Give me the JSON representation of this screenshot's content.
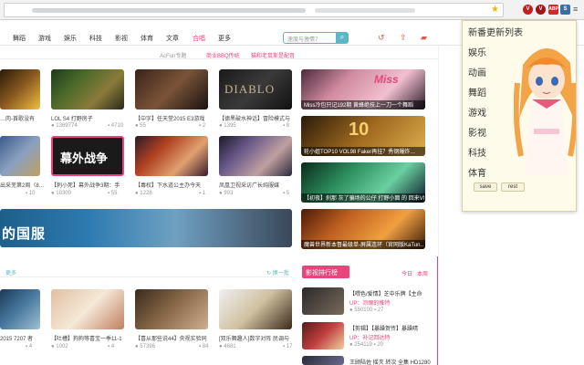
{
  "browser": {
    "ext_icons": [
      "V",
      "V",
      "ABP",
      "⚙",
      "S"
    ]
  },
  "nav": {
    "items": [
      "舞蹈",
      "游戏",
      "娱乐",
      "科技",
      "影视",
      "体育",
      "文章",
      "合唱",
      "更多"
    ],
    "active_index": 7,
    "search_placeholder": "速度与激情7",
    "icons": [
      "history-icon",
      "upload-icon",
      "folder-icon"
    ]
  },
  "subbar": {
    "items": [
      "AcFun专题",
      "商业BBQ传统",
      "猫和老鼠斯是配音"
    ]
  },
  "grid_row1": [
    {
      "title": "…肉-首歌没有",
      "stat1": "",
      "stat2": ""
    },
    {
      "title": "LOL S4 打野房子",
      "stat1": "1369774",
      "stat2": "4710"
    },
    {
      "title": "【中字】任天堂2015 E3游戏",
      "stat1": "55",
      "stat2": "2"
    },
    {
      "title": "【德黑破水神话】冒险模式与",
      "stat1": "1395",
      "stat2": "8"
    }
  ],
  "grid_row2": [
    {
      "title": "出采芜第2周（8…",
      "stat1": "10",
      "stat2": ""
    },
    {
      "title": "【刺小死】幕外战争3期：手",
      "stat1": "10300",
      "stat2": "55"
    },
    {
      "title": "【毒权】下水道公主办今天",
      "stat1": "1228",
      "stat2": "1"
    },
    {
      "title": "凤凰卫视采访广长纯服媒",
      "stat1": "993",
      "stat2": "5"
    }
  ],
  "right_feature": [
    "Miss冷包只记192期 黄蜂绝技上一刀一个舞蹈",
    "轮小姐TOP10 VOL98 Faker再挂？秀钢爆炸…",
    "【初夜】刹那 灰了骗场的公仔 打野小面 的 回来VN…",
    "魔兽世界新本督最级单-屏属连环（官网版KaTun…"
  ],
  "thumb_texts": {
    "fan": "幕外战争",
    "diablo": "DIABLO",
    "miss": "Miss",
    "ten": "10"
  },
  "banner": {
    "text": "的国服"
  },
  "section": {
    "more": "更多",
    "refresh": "换一批"
  },
  "ranking": {
    "header": "影视排行榜",
    "tabs": [
      "今日",
      "本周"
    ],
    "rows": [
      {
        "title": "【喂色/爱情】芝中乐牌【主命",
        "up": "UP：凉眼的推特",
        "views": "550100",
        "comments": "27"
      },
      {
        "title": "【剪辑】【暴躁贺传】暴躁晴",
        "up": "UP：补记回达特",
        "views": "254119",
        "comments": "20"
      },
      {
        "title": "王顾陆佐 摇灭 转次 全集 HD1280",
        "up": "",
        "views": "",
        "comments": ""
      }
    ]
  },
  "grid_row3": [
    {
      "title": "2015 7207 者",
      "stat1": "4",
      "stat2": ""
    },
    {
      "title": "【吐槽】狗狗等喜宝一季11-1",
      "stat1": "1002",
      "stat2": "4"
    },
    {
      "title": "【喜从那些说44】央视实验同",
      "stat1": "57396",
      "stat2": "84"
    },
    {
      "title": "[双乐舞趣人]数字对阵 民调与",
      "stat1": "4681",
      "stat2": "17"
    }
  ],
  "popup": {
    "title": "新番更新列表",
    "items": [
      "娱乐",
      "动画",
      "舞蹈",
      "游戏",
      "影视",
      "科技",
      "体育"
    ],
    "save": "save",
    "reset": "rest"
  }
}
